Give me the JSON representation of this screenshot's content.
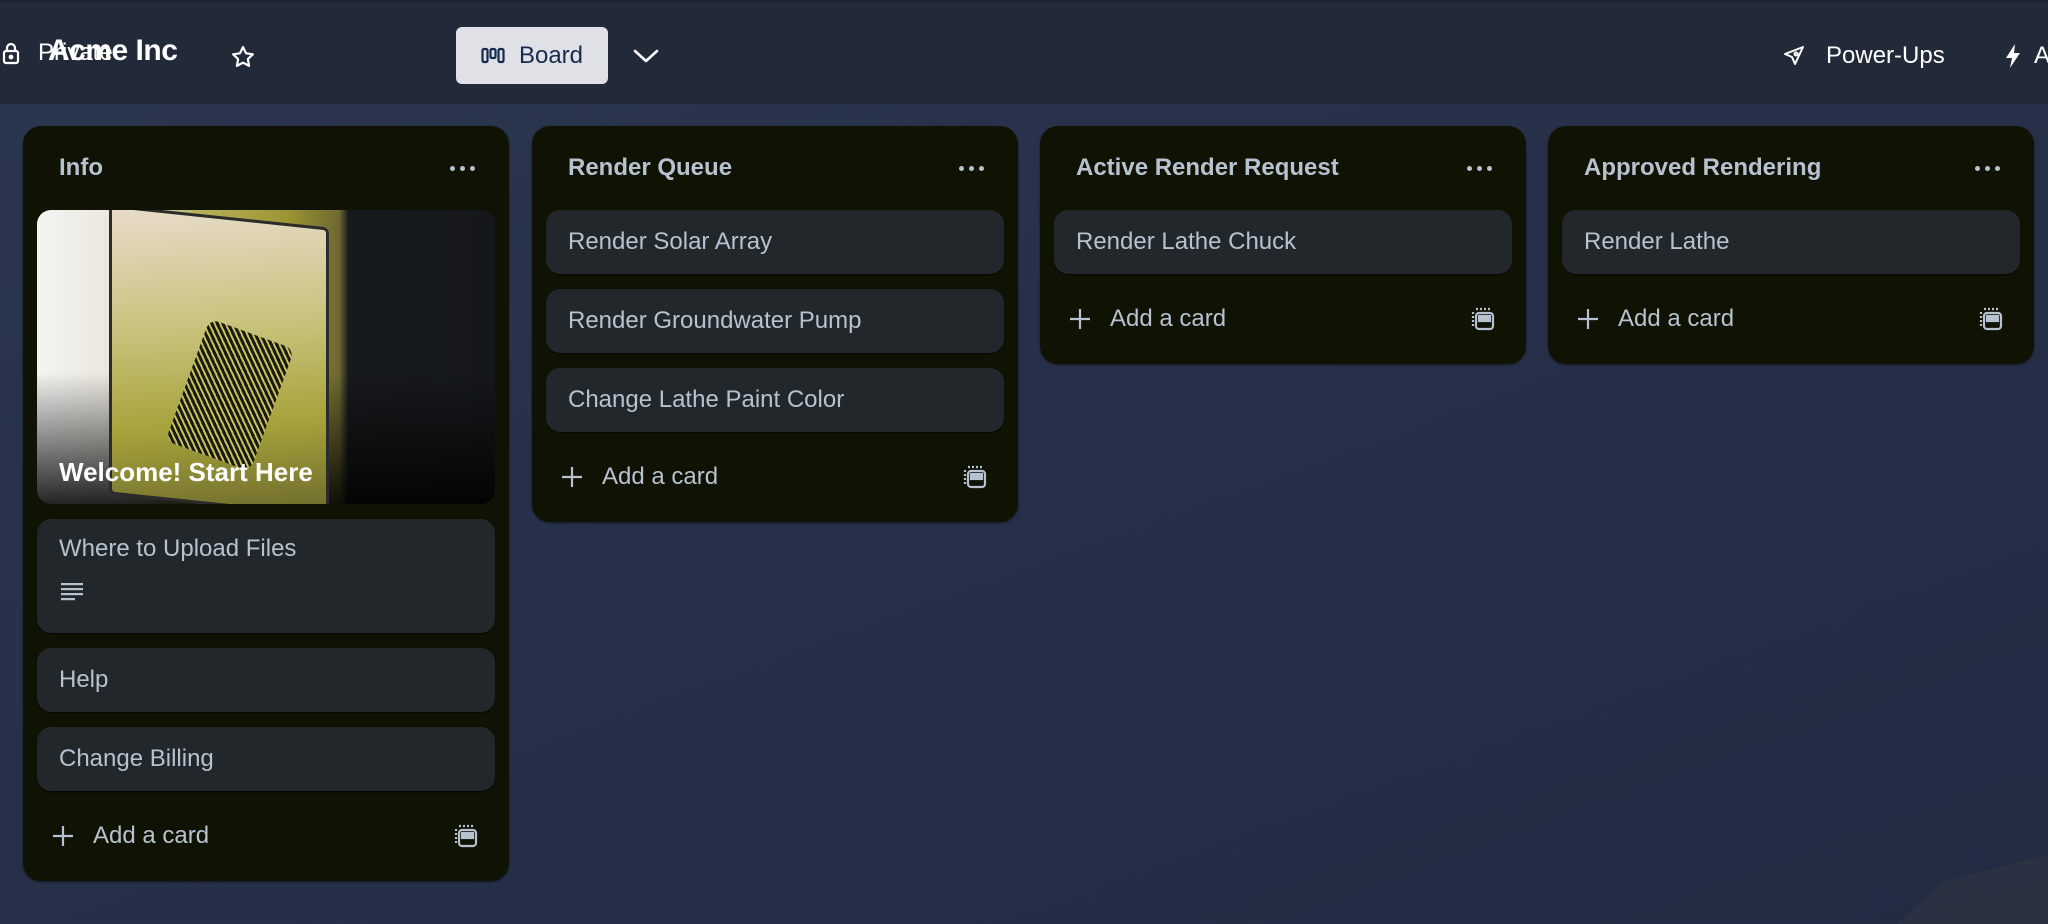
{
  "header": {
    "board_title": "Acme Inc",
    "star_icon": "star-icon",
    "visibility_label": "Private",
    "visibility_icon": "lock-icon",
    "view_label": "Board",
    "view_icon": "board-columns-icon",
    "view_switcher_icon": "chevron-down-icon",
    "powerups_label": "Power-Ups",
    "powerups_icon": "rocket-icon",
    "automation_label": "Automation",
    "automation_icon": "lightning-icon"
  },
  "lists": [
    {
      "title": "Info",
      "cover_card": {
        "title": "Welcome! Start Here"
      },
      "cards": [
        {
          "title": "Where to Upload Files",
          "has_description": true
        },
        {
          "title": "Help"
        },
        {
          "title": "Change Billing"
        }
      ],
      "add_label": "Add a card"
    },
    {
      "title": "Render Queue",
      "cards": [
        {
          "title": "Render Solar Array"
        },
        {
          "title": "Render Groundwater Pump"
        },
        {
          "title": "Change Lathe Paint Color"
        }
      ],
      "add_label": "Add a card"
    },
    {
      "title": "Active Render Request",
      "cards": [
        {
          "title": "Render Lathe Chuck"
        }
      ],
      "add_label": "Add a card"
    },
    {
      "title": "Approved Rendering",
      "cards": [
        {
          "title": "Render Lathe"
        }
      ],
      "add_label": "Add a card"
    }
  ],
  "colors": {
    "board_bg": "#27314a",
    "header_bg": "#222938",
    "list_bg": "#101204",
    "card_bg": "#22272b",
    "text": "#b6c2cf"
  }
}
